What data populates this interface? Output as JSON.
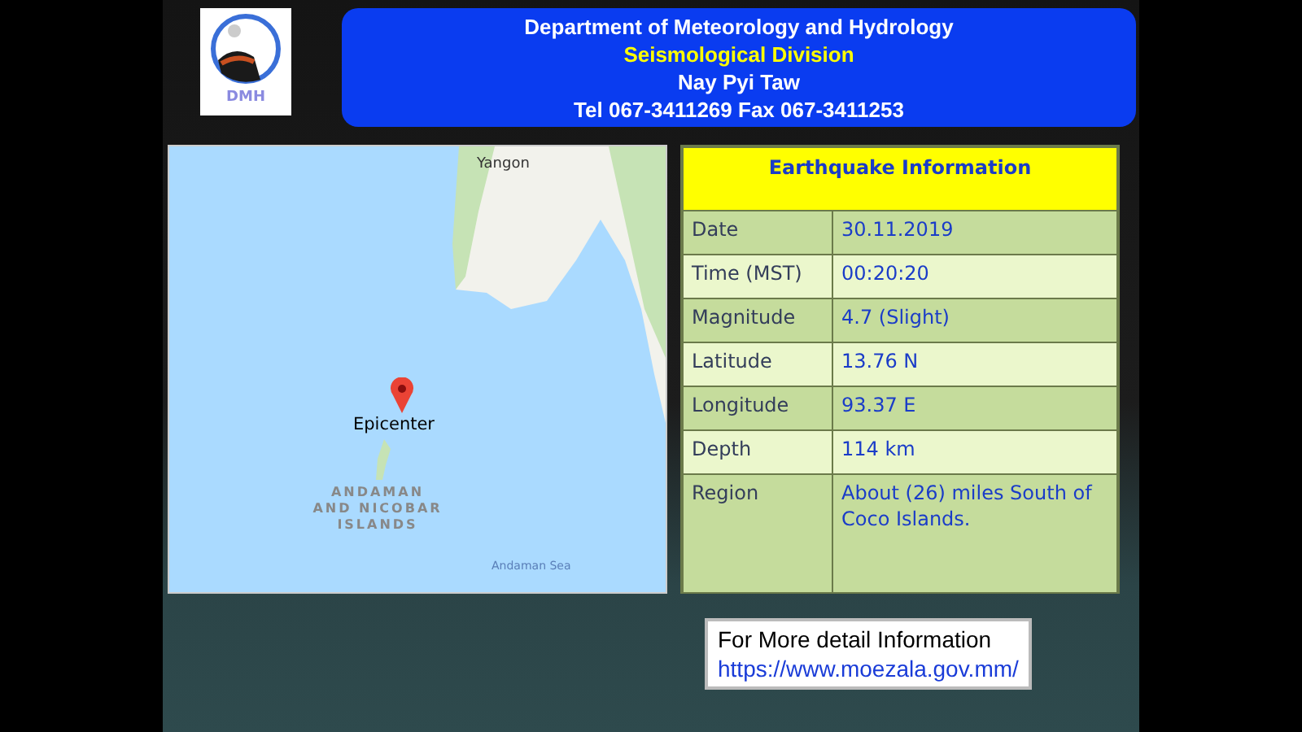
{
  "header": {
    "lines": [
      {
        "text": "Department of Meteorology and Hydrology",
        "color": "#ffffff"
      },
      {
        "text": "Seismological  Division",
        "color": "#ffff00"
      },
      {
        "text": "Nay Pyi Taw",
        "color": "#ffffff"
      },
      {
        "text": "Tel 067-3411269  Fax 067-3411253",
        "color": "#ffffff"
      }
    ],
    "logo_text": "DMH"
  },
  "map": {
    "city": "Yangon",
    "marker_label": "Epicenter",
    "islands": "ANDAMAN AND NICOBAR ISLANDS",
    "sea": "Andaman Sea"
  },
  "table": {
    "title": "Earthquake Information",
    "rows": [
      {
        "label": "Date",
        "value": "30.11.2019"
      },
      {
        "label": "Time (MST)",
        "value": "00:20:20"
      },
      {
        "label": "Magnitude",
        "value": "4.7 (Slight)"
      },
      {
        "label": "Latitude",
        "value": "13.76 N"
      },
      {
        "label": "Longitude",
        "value": "93.37 E"
      },
      {
        "label": "Depth",
        "value": "114 km"
      },
      {
        "label": "Region",
        "value": "About (26) miles South of Coco Islands."
      }
    ]
  },
  "info_box": {
    "text": "For More detail Information",
    "link": "https://www.moezala.gov.mm/"
  }
}
